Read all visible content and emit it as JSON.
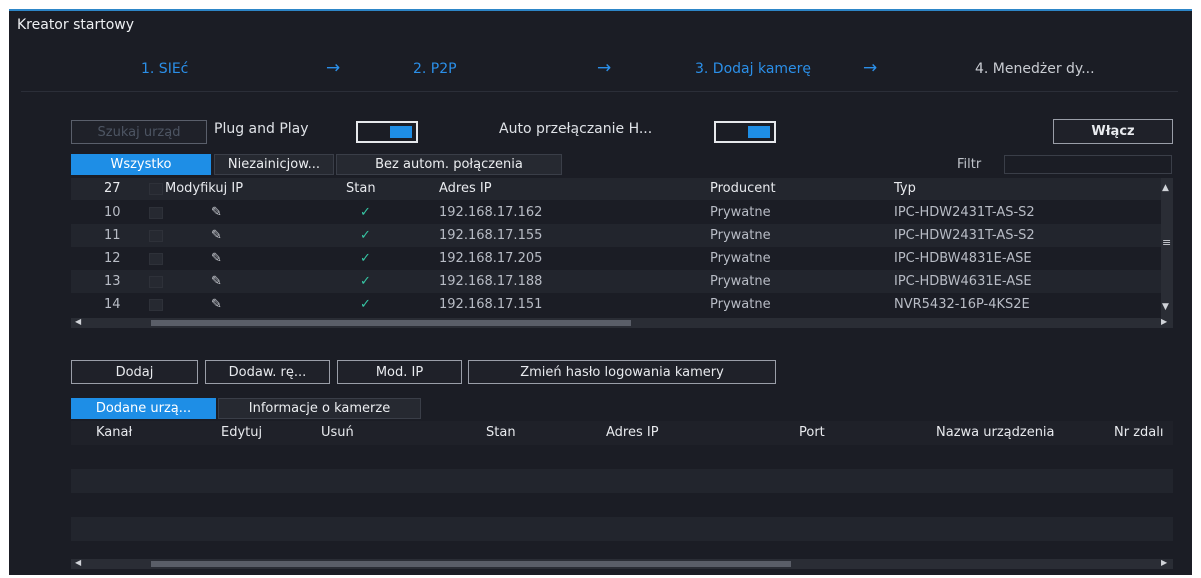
{
  "window": {
    "title": "Kreator startowy"
  },
  "steps": [
    {
      "label": "1.  SIEć",
      "active": true
    },
    {
      "label": "2.  P2P",
      "active": true
    },
    {
      "label": "3.  Dodaj kamerę",
      "active": true
    },
    {
      "label": "4.  Menedżer dy...",
      "active": false
    }
  ],
  "step_arrow": "→",
  "toolbar": {
    "search_button": "Szukaj urząd",
    "plug_and_play_label": "Plug and Play",
    "auto_switch_label": "Auto przełączanie H...",
    "enable_button": "Włącz"
  },
  "device_tabs": [
    "Wszystko",
    "Niezainicjow...",
    "Bez autom. połączenia"
  ],
  "filter": {
    "label": "Filtr",
    "value": ""
  },
  "device_table": {
    "count": "27",
    "headers": {
      "modify_ip": "Modyfikuj IP",
      "status": "Stan",
      "ip": "Adres IP",
      "vendor": "Producent",
      "type": "Typ"
    },
    "rows": [
      {
        "no": "10",
        "status": "✓",
        "ip": "192.168.17.162",
        "vendor": "Prywatne",
        "type": "IPC-HDW2431T-AS-S2"
      },
      {
        "no": "11",
        "status": "✓",
        "ip": "192.168.17.155",
        "vendor": "Prywatne",
        "type": "IPC-HDW2431T-AS-S2"
      },
      {
        "no": "12",
        "status": "✓",
        "ip": "192.168.17.205",
        "vendor": "Prywatne",
        "type": "IPC-HDBW4831E-ASE"
      },
      {
        "no": "13",
        "status": "✓",
        "ip": "192.168.17.188",
        "vendor": "Prywatne",
        "type": "IPC-HDBW4631E-ASE"
      },
      {
        "no": "14",
        "status": "✓",
        "ip": "192.168.17.151",
        "vendor": "Prywatne",
        "type": "NVR5432-16P-4KS2E"
      }
    ]
  },
  "actions": {
    "add": "Dodaj",
    "manual_add": "Dodaw. rę...",
    "modify_ip": "Mod. IP",
    "change_password": "Zmień hasło logowania kamery"
  },
  "added_tabs": [
    "Dodane urzą...",
    "Informacje o kamerze"
  ],
  "added_table": {
    "headers": {
      "channel": "Kanał",
      "edit": "Edytuj",
      "delete": "Usuń",
      "status": "Stan",
      "ip": "Adres IP",
      "port": "Port",
      "device_name": "Nazwa urządzenia",
      "remote_no": "Nr zdalı"
    }
  },
  "colors": {
    "accent": "#1e8ee6",
    "background": "#1b1d25",
    "ok": "#36c6a4"
  }
}
